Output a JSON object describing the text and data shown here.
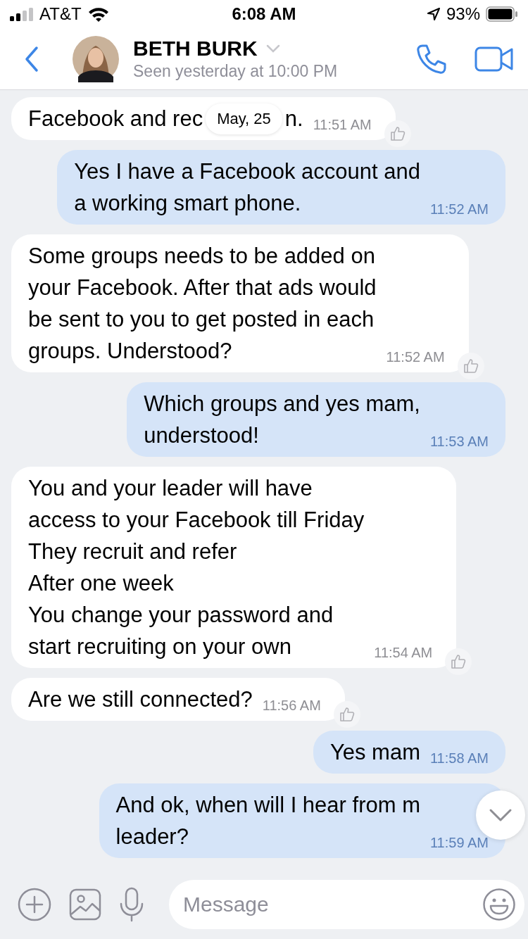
{
  "status_bar": {
    "carrier": "AT&T",
    "time": "6:08 AM",
    "battery": "93%"
  },
  "header": {
    "name": "BETH BURK",
    "status": "Seen yesterday at 10:00 PM"
  },
  "date_label": "May, 25",
  "messages": [
    {
      "kind": "incoming",
      "text": "Facebook and rec",
      "tail": "n.",
      "time": "11:51 AM"
    },
    {
      "kind": "outgoing",
      "text": "Yes I have a Facebook account and\na working smart phone.",
      "time": "11:52 AM"
    },
    {
      "kind": "incoming",
      "text": "Some groups needs to be added on\nyour Facebook. After that ads would\nbe sent to you to get posted in each\ngroups. Understood?",
      "time": "11:52 AM"
    },
    {
      "kind": "outgoing",
      "text": "Which groups and yes mam,\nunderstood!",
      "time": "11:53 AM"
    },
    {
      "kind": "incoming",
      "text": "You and your leader will have\naccess to your Facebook till Friday\nThey recruit and refer\nAfter one week\nYou change your password and\nstart recruiting on your own",
      "time": "11:54 AM"
    },
    {
      "kind": "incoming",
      "text": "Are we still connected?",
      "time": "11:56 AM"
    },
    {
      "kind": "outgoing",
      "text": "Yes mam",
      "time": "11:58 AM"
    },
    {
      "kind": "outgoing",
      "text": "And ok, when will I hear from m\nleader?",
      "time": "11:59 AM"
    }
  ],
  "composer": {
    "placeholder": "Message"
  }
}
